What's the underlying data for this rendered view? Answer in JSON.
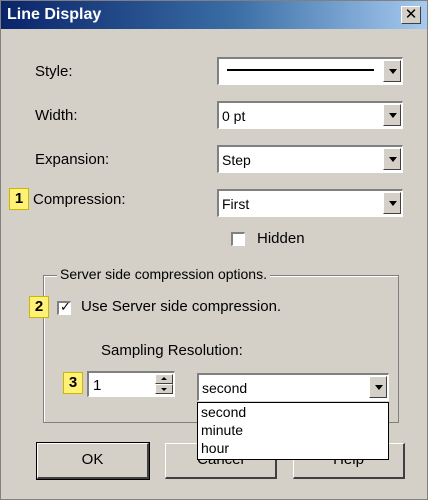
{
  "window": {
    "title": "Line Display",
    "close_symbol": "✕"
  },
  "fields": {
    "style": {
      "label": "Style:",
      "value": ""
    },
    "width": {
      "label": "Width:",
      "value": "0 pt"
    },
    "expansion": {
      "label": "Expansion:",
      "value": "Step"
    },
    "compression": {
      "label": "Compression:",
      "value": "First"
    }
  },
  "hidden_checkbox": {
    "label": "Hidden",
    "checked": false
  },
  "server_group": {
    "title": "Server side compression options.",
    "use_server": {
      "label": "Use Server side compression.",
      "checked": true
    },
    "sampling_label": "Sampling Resolution:",
    "sampling_value": "1",
    "unit": {
      "value": "second",
      "options": [
        "second",
        "minute",
        "hour"
      ]
    }
  },
  "badges": [
    "1",
    "2",
    "3"
  ],
  "buttons": {
    "ok": "OK",
    "cancel": "Cancel",
    "help": "Help"
  },
  "icons": {
    "close": "close-icon",
    "dropdown": "chevron-down-icon",
    "spin_up": "spin-up-icon",
    "spin_down": "spin-down-icon",
    "check": "checkmark-icon"
  }
}
